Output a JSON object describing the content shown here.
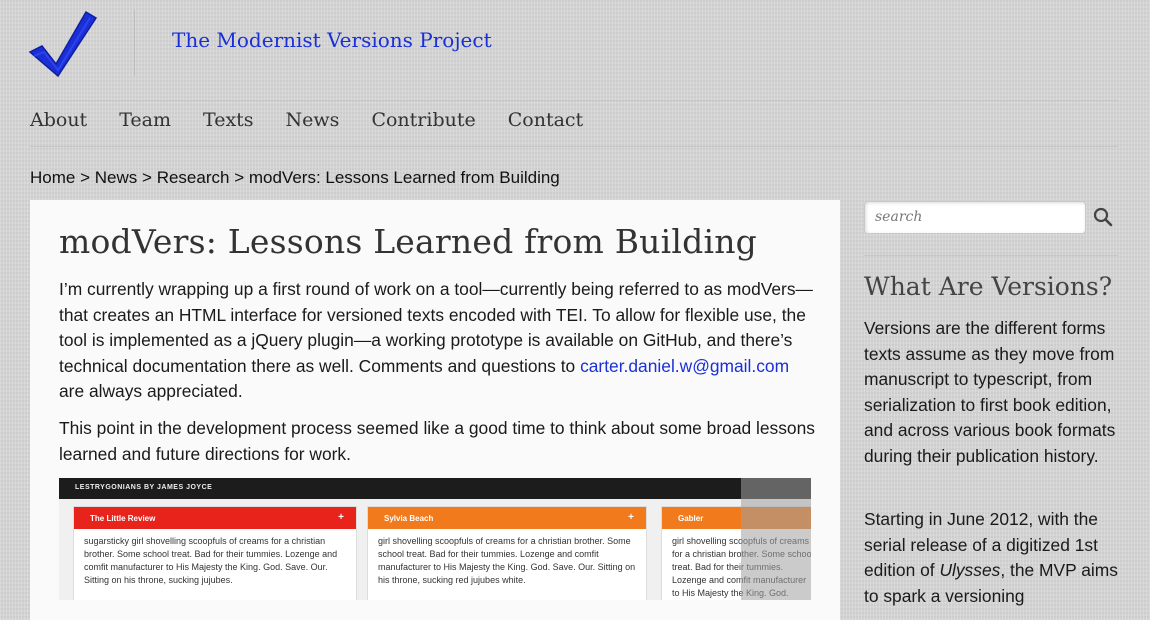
{
  "header": {
    "site_title": "The Modernist Versions Project",
    "logo_icon": "checkmark-logo",
    "accent_color": "#1a2fd6"
  },
  "nav": {
    "items": [
      {
        "label": "About"
      },
      {
        "label": "Team"
      },
      {
        "label": "Texts"
      },
      {
        "label": "News"
      },
      {
        "label": "Contribute"
      },
      {
        "label": "Contact"
      }
    ]
  },
  "breadcrumb": {
    "items": [
      "Home",
      "News",
      "Research",
      "modVers: Lessons Learned from Building"
    ],
    "separator": ">"
  },
  "post": {
    "title": "modVers: Lessons Learned from Building",
    "p1_text": "I’m currently wrapping up a first round of work on a tool—currently being referred to as modVers—that creates an HTML interface for versioned texts encoded with TEI. To allow for flexible use, the tool is implemented as a jQuery plugin—a working prototype is available on GitHub, and there’s technical documentation there as well. Comments and questions to",
    "p1_link": "carter.daniel.w@gmail.com",
    "p1_tail": "are always appreciated.",
    "p2_text": "This point in the development process seemed like a good time to think about some broad lessons learned and future directions for work."
  },
  "screenshot": {
    "bar_title": "LESTRYGONIANS BY JAMES JOYCE",
    "columns": [
      {
        "title": "The Little Review",
        "plus": "+",
        "color": "#e8231c",
        "text": "sugarsticky girl shovelling scoopfuls of creams for a christian brother. Some school treat. Bad for their tummies. Lozenge and comfit manufacturer to His Majesty the King. God. Save. Our.   Sitting on his throne, sucking jujubes."
      },
      {
        "title": "Sylvia Beach",
        "plus": "+",
        "color": "#f07a1c",
        "text": "girl shovelling scoopfuls of creams for a christian brother. Some school treat. Bad for their tummies. Lozenge and comfit manufacturer to His Majesty the King. God. Save. Our.   Sitting on his throne, sucking red jujubes white."
      },
      {
        "title": "Gabler",
        "plus": "",
        "color": "#f07a1c",
        "text": "girl shovelling scoopfuls of creams for a christian brother. Some school treat. Bad for their tummies. Lozenge and comfit manufacturer to His Majesty the King. God. Save. Our.   Sitting on his throne sucking re"
      }
    ]
  },
  "sidebar": {
    "search_placeholder": "search",
    "heading": "What Are Versions?",
    "p1": "Versions are the different forms texts assume as they move from manuscript to typescript, from serialization to first book edition, and across various book formats during their publication history.",
    "p2_a": "Starting in June 2012, with the serial release of a digitized 1st edition of",
    "p2_em": "Ulysses",
    "p2_b": ", the MVP aims to spark a versioning"
  }
}
